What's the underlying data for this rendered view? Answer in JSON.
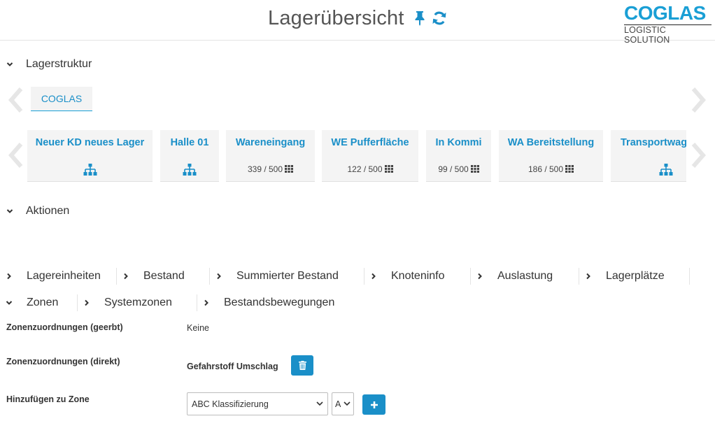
{
  "header": {
    "title": "Lagerübersicht",
    "pin_icon": "thumbtack-icon",
    "refresh_icon": "sync-icon",
    "logo_main": "COGLAS",
    "logo_sub": "LOGISTIC SOLUTION",
    "accent_color": "#1a8fc8"
  },
  "sections": {
    "structure_label": "Lagerstruktur",
    "actions_label": "Aktionen"
  },
  "breadcrumb": {
    "root": "COGLAS"
  },
  "nodes": [
    {
      "name": "Neuer KD neues Lager",
      "icon": "sitemap-icon",
      "capacity": ""
    },
    {
      "name": "Halle 01",
      "icon": "sitemap-icon",
      "capacity": ""
    },
    {
      "name": "Wareneingang",
      "icon": "grid-icon",
      "capacity": "339 / 500"
    },
    {
      "name": "WE Pufferfläche",
      "icon": "grid-icon",
      "capacity": "122 / 500"
    },
    {
      "name": "In Kommi",
      "icon": "grid-icon",
      "capacity": "99 / 500"
    },
    {
      "name": "WA Bereitstellung",
      "icon": "grid-icon",
      "capacity": "186 / 500"
    },
    {
      "name": "Transportwag",
      "icon": "sitemap-icon",
      "capacity": ""
    }
  ],
  "tabs_row1": [
    {
      "label": "Lagereinheiten",
      "state": "collapsed"
    },
    {
      "label": "Bestand",
      "state": "collapsed"
    },
    {
      "label": "Summierter Bestand",
      "state": "collapsed"
    },
    {
      "label": "Knoteninfo",
      "state": "collapsed"
    },
    {
      "label": "Auslastung",
      "state": "collapsed"
    },
    {
      "label": "Lagerplätze",
      "state": "collapsed"
    }
  ],
  "tabs_row2": [
    {
      "label": "Zonen",
      "state": "expanded"
    },
    {
      "label": "Systemzonen",
      "state": "collapsed"
    },
    {
      "label": "Bestandsbewegungen",
      "state": "collapsed"
    }
  ],
  "zones": {
    "inherited_label": "Zonenzuordnungen (geerbt)",
    "inherited_value": "Keine",
    "direct_label": "Zonenzuordnungen (direkt)",
    "direct_value": "Gefahrstoff Umschlag",
    "delete_icon": "trash-icon",
    "add_label": "Hinzufügen zu Zone",
    "zone_select_value": "ABC Klassifizierung",
    "class_select_value": "A",
    "add_icon": "plus-icon"
  }
}
